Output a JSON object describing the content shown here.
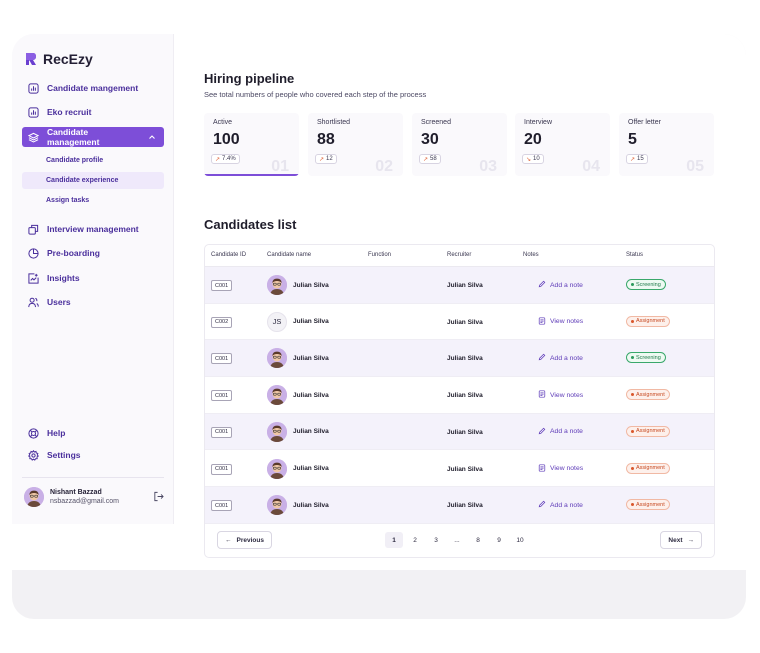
{
  "sidebar": {
    "brand": "RecEzy",
    "nav": [
      {
        "label": "Candidate mangement",
        "icon": "chart-icon"
      },
      {
        "label": "Eko recruit",
        "icon": "chart-icon"
      },
      {
        "label": "Candidate management",
        "icon": "layers-icon",
        "active": true
      },
      {
        "label": "Interview management",
        "icon": "copy-icon"
      },
      {
        "label": "Pre-boarding",
        "icon": "pie-chart-icon"
      },
      {
        "label": "Insights",
        "icon": "insights-icon"
      },
      {
        "label": "Users",
        "icon": "users-icon"
      }
    ],
    "subnav": [
      {
        "label": "Candidate profile"
      },
      {
        "label": "Candidate experience",
        "active": true
      },
      {
        "label": "Assign tasks"
      }
    ],
    "help": "Help",
    "settings": "Settings",
    "user": {
      "name": "Nishant Bazzad",
      "email": "nsbazzad@gmail.com"
    }
  },
  "header": {
    "title": "Hiring pipeline",
    "subtitle": "See total numbers of people who covered each step of the process"
  },
  "stats": [
    {
      "label": "Active",
      "value": "100",
      "delta": "7.4%",
      "trend": "up",
      "step": "01",
      "selected": true
    },
    {
      "label": "Shortlisted",
      "value": "88",
      "delta": "12",
      "trend": "up",
      "step": "02"
    },
    {
      "label": "Screened",
      "value": "30",
      "delta": "58",
      "trend": "up",
      "step": "03"
    },
    {
      "label": "Interview",
      "value": "20",
      "delta": "10",
      "trend": "down",
      "step": "04"
    },
    {
      "label": "Offer letter",
      "value": "5",
      "delta": "15",
      "trend": "up",
      "step": "05"
    }
  ],
  "candidates": {
    "title": "Candidates list",
    "columns": [
      "Candidate ID",
      "Candidate name",
      "Function",
      "Recruiter",
      "Notes",
      "Status"
    ],
    "rows": [
      {
        "id": "C001",
        "name": "Julian Silva",
        "avatar": "photo",
        "initials": "",
        "function": "",
        "recruiter": "Julian Silva",
        "note": "Add a note",
        "note_icon": "pencil-icon",
        "status": "Screening"
      },
      {
        "id": "C002",
        "name": "Julian Silva",
        "avatar": "initials",
        "initials": "JS",
        "function": "",
        "recruiter": "Julian Silva",
        "note": "View notes",
        "note_icon": "document-icon",
        "status": "Assignment"
      },
      {
        "id": "C001",
        "name": "Julian Silva",
        "avatar": "photo",
        "initials": "",
        "function": "",
        "recruiter": "Julian Silva",
        "note": "Add a note",
        "note_icon": "pencil-icon",
        "status": "Screening"
      },
      {
        "id": "C001",
        "name": "Julian Silva",
        "avatar": "photo",
        "initials": "",
        "function": "",
        "recruiter": "Julian Silva",
        "note": "View notes",
        "note_icon": "document-icon",
        "status": "Assignment"
      },
      {
        "id": "C001",
        "name": "Julian Silva",
        "avatar": "photo",
        "initials": "",
        "function": "",
        "recruiter": "Julian Silva",
        "note": "Add a note",
        "note_icon": "pencil-icon",
        "status": "Assignment"
      },
      {
        "id": "C001",
        "name": "Julian Silva",
        "avatar": "photo",
        "initials": "",
        "function": "",
        "recruiter": "Julian Silva",
        "note": "View notes",
        "note_icon": "document-icon",
        "status": "Assignment"
      },
      {
        "id": "C001",
        "name": "Julian Silva",
        "avatar": "photo",
        "initials": "",
        "function": "",
        "recruiter": "Julian Silva",
        "note": "Add a note",
        "note_icon": "pencil-icon",
        "status": "Assignment"
      }
    ]
  },
  "pagination": {
    "previous": "Previous",
    "next": "Next",
    "pages": [
      "1",
      "2",
      "3",
      "...",
      "8",
      "9",
      "10"
    ],
    "current": "1"
  },
  "colors": {
    "accent": "#7d4ed8",
    "screening": "#2c9a5c",
    "assignment": "#d9572c"
  }
}
